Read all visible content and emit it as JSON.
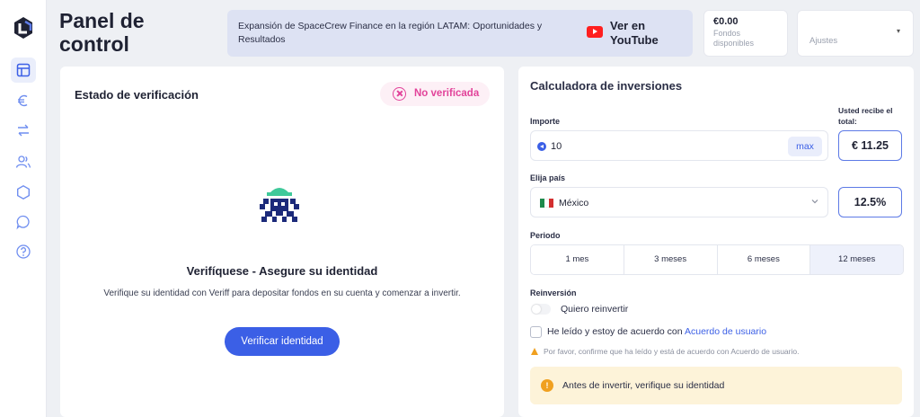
{
  "header": {
    "title": "Panel de control",
    "banner_text": "Expansión de SpaceCrew Finance en la región LATAM: Oportunidades y Resultados",
    "youtube_label": "Ver en YouTube",
    "funds_amount": "€0.00",
    "funds_label": "Fondos disponibles",
    "settings_label": "Ajustes"
  },
  "sidebar": {
    "items": [
      {
        "icon": "dashboard-icon",
        "active": true
      },
      {
        "icon": "euro-icon"
      },
      {
        "icon": "transfer-icon"
      },
      {
        "icon": "users-icon"
      },
      {
        "icon": "hexagon-icon"
      },
      {
        "icon": "chat-icon"
      },
      {
        "icon": "help-icon"
      }
    ]
  },
  "verification": {
    "title": "Estado de verificación",
    "status": "No verificada",
    "heading": "Verifíquese - Asegure su identidad",
    "description": "Verifique su identidad con Veriff para depositar fondos en su cuenta y comenzar a invertir.",
    "button_label": "Verificar identidad"
  },
  "calculator": {
    "title": "Calculadora de inversiones",
    "amount_label": "Importe",
    "amount_value": "10",
    "max_label": "max",
    "receive_label": "Usted recibe el total:",
    "receive_value": "€ 11.25",
    "country_label": "Elija país",
    "country_value": "México",
    "rate_value": "12.5%",
    "period_label": "Periodo",
    "periods": [
      "1 mes",
      "3 meses",
      "6 meses",
      "12 meses"
    ],
    "selected_period": "12 meses",
    "reinvest_label": "Reinversión",
    "reinvest_toggle_label": "Quiero reinvertir",
    "agree_text": "He leído y estoy de acuerdo con",
    "agree_link": "Acuerdo de usuario",
    "warning_text": "Por favor, confirme que ha leído y está de acuerdo con Acuerdo de usuario.",
    "info_text": "Antes de invertir, verifique su identidad"
  },
  "colors": {
    "accent": "#3b5fe6",
    "pink_status": "#e2439a",
    "warning": "#f0a020",
    "background": "#eef0f4"
  }
}
